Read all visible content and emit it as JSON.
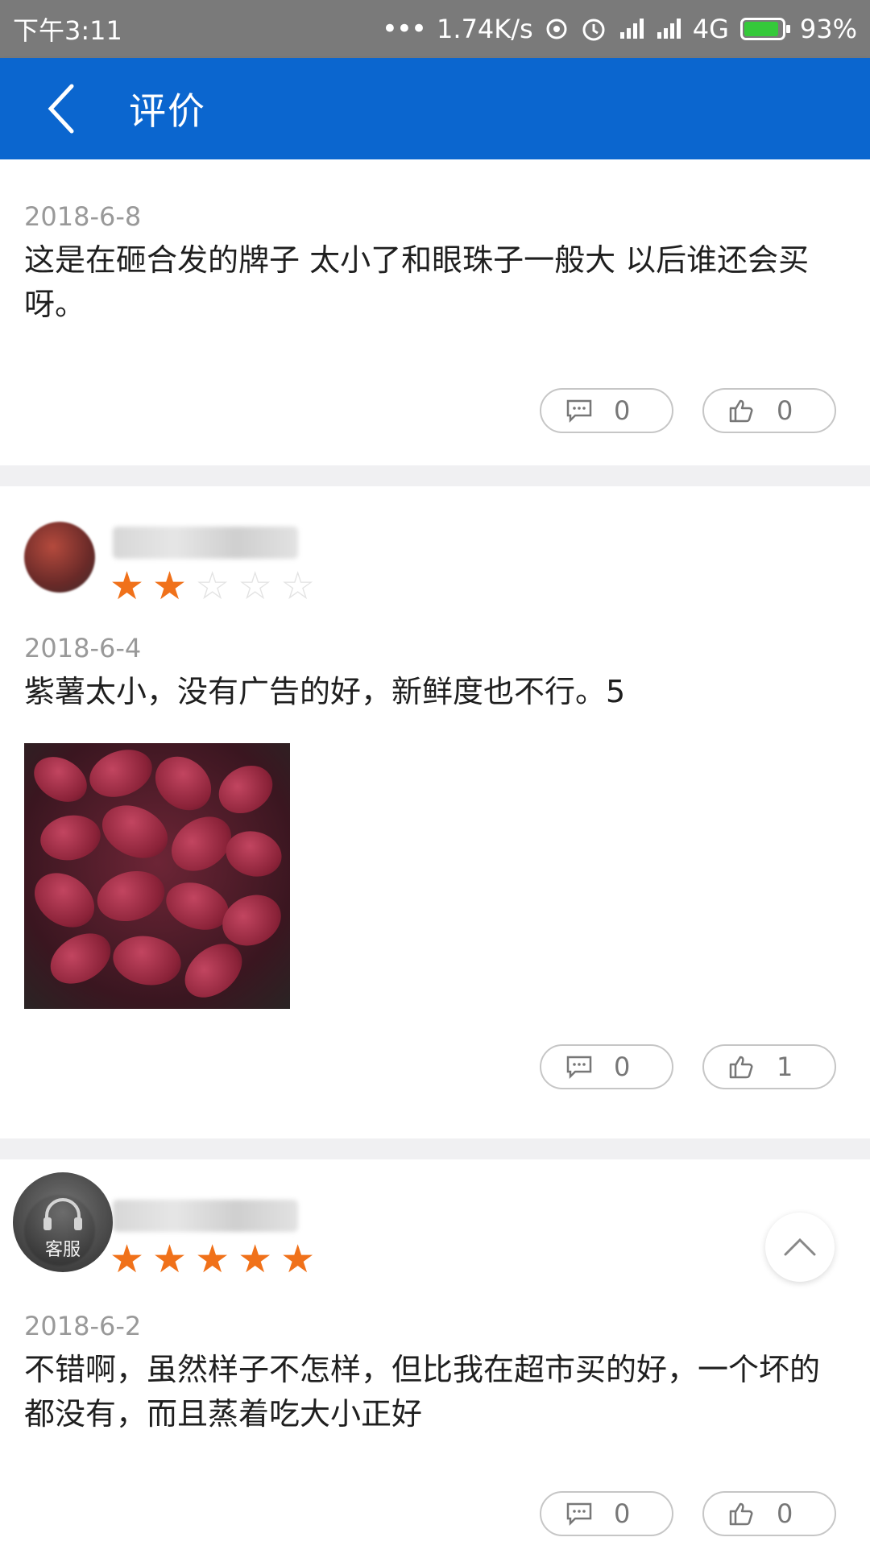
{
  "status_bar": {
    "time": "下午3:11",
    "network_speed": "1.74K/s",
    "network_type": "4G",
    "battery": "93%",
    "battery_level": 0.93,
    "icons": [
      "dots-icon",
      "hotspot-icon",
      "alarm-icon",
      "signal-icon",
      "signal-icon"
    ]
  },
  "header": {
    "title": "评价",
    "back_icon": "chevron-left-icon",
    "background": "#0b66cf"
  },
  "reviews": [
    {
      "date": "2018-6-8",
      "text": "这是在砸合发的牌子 太小了和眼珠子一般大 以后谁还会买呀。",
      "comments": "0",
      "likes": "0"
    },
    {
      "rating": 2,
      "date": "2018-6-4",
      "text": "紫薯太小，没有广告的好，新鲜度也不行。5",
      "has_photo": true,
      "comments": "0",
      "likes": "1"
    },
    {
      "rating": 5,
      "date": "2018-6-2",
      "text": "不错啊，虽然样子不怎样，但比我在超市买的好，一个坏的都没有，而且蒸着吃大小正好",
      "comments": "0",
      "likes": "0"
    }
  ],
  "floating": {
    "customer_service_label": "客服",
    "scroll_top_icon": "chevron-up-icon"
  },
  "colors": {
    "star_on": "#f0711a",
    "star_off": "#e3e3e3",
    "divider": "#f0f0f2"
  }
}
